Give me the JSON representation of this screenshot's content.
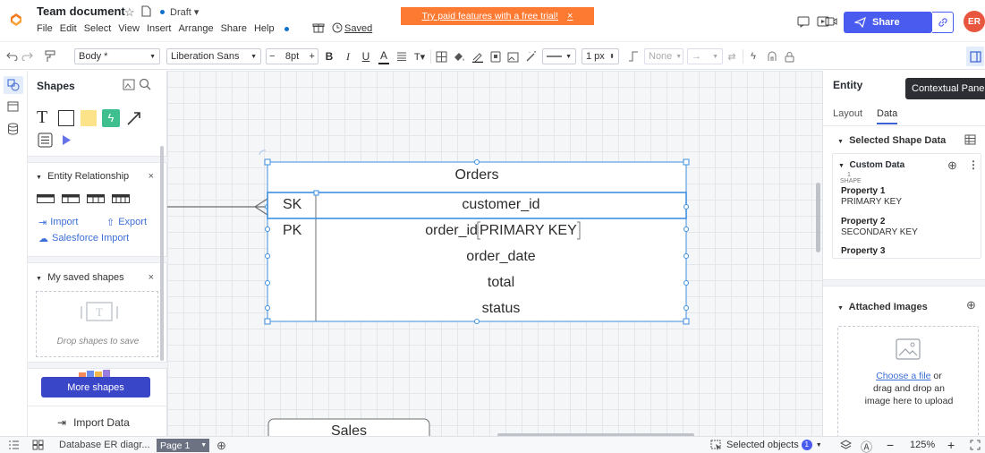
{
  "header": {
    "doc_title": "Team document",
    "draft_label": "Draft ▾",
    "menus": [
      "File",
      "Edit",
      "Select",
      "View",
      "Insert",
      "Arrange",
      "Share",
      "Help"
    ],
    "saved_label": "Saved",
    "promo_text": "Try paid features with a free trial!",
    "promo_close": "×",
    "share_label": "Share",
    "avatar_initials": "ER"
  },
  "toolbar": {
    "style_value": "Body *",
    "font_value": "Liberation Sans",
    "font_size": "8pt",
    "minus": "−",
    "plus": "+",
    "bold": "B",
    "italic": "I",
    "underline": "U",
    "font_color": "A",
    "line_width": "1 px",
    "arrow_none": "None"
  },
  "left_panel": {
    "title": "Shapes",
    "entity_section": "Entity Relationship",
    "import_label": "Import",
    "export_label": "Export",
    "salesforce_label": "Salesforce Import",
    "saved_section": "My saved shapes",
    "drop_hint": "Drop shapes to save",
    "more_shapes": "More shapes",
    "import_data": "Import Data",
    "close": "×"
  },
  "canvas": {
    "table_title": "Orders",
    "rows": [
      {
        "key": "SK",
        "field": "customer_id"
      },
      {
        "key": "PK",
        "field": "order_id"
      },
      {
        "key": "",
        "field": "order_date"
      },
      {
        "key": "",
        "field": "total"
      },
      {
        "key": "",
        "field": "status"
      }
    ],
    "editing_text": "PRIMARY KEY",
    "second_table_title": "Sales"
  },
  "right_panel": {
    "title": "Entity",
    "tooltip": "Contextual Panel",
    "tabs": [
      "Layout",
      "Data"
    ],
    "selected_shape_data": "Selected Shape Data",
    "custom_data": "Custom Data",
    "shape_count": "1",
    "shape_label": "SHAPE",
    "properties": [
      {
        "name": "Property 1",
        "value": "PRIMARY KEY"
      },
      {
        "name": "Property 2",
        "value": "SECONDARY KEY"
      },
      {
        "name": "Property 3",
        "value": ""
      }
    ],
    "attached_images": "Attached Images",
    "choose_file": "Choose a file",
    "upload_or": " or",
    "upload_hint": "drag and drop an image here to upload"
  },
  "statusbar": {
    "doc_tab": "Database ER diagr...",
    "page_tab": "Page 1",
    "selected_objects": "Selected objects",
    "selected_count": "1",
    "zoom": "125%",
    "zoom_minus": "−",
    "zoom_plus": "+"
  },
  "colors": {
    "accent": "#4a5bf0",
    "promo": "#fd7a32",
    "selection": "#3d8fe0"
  }
}
